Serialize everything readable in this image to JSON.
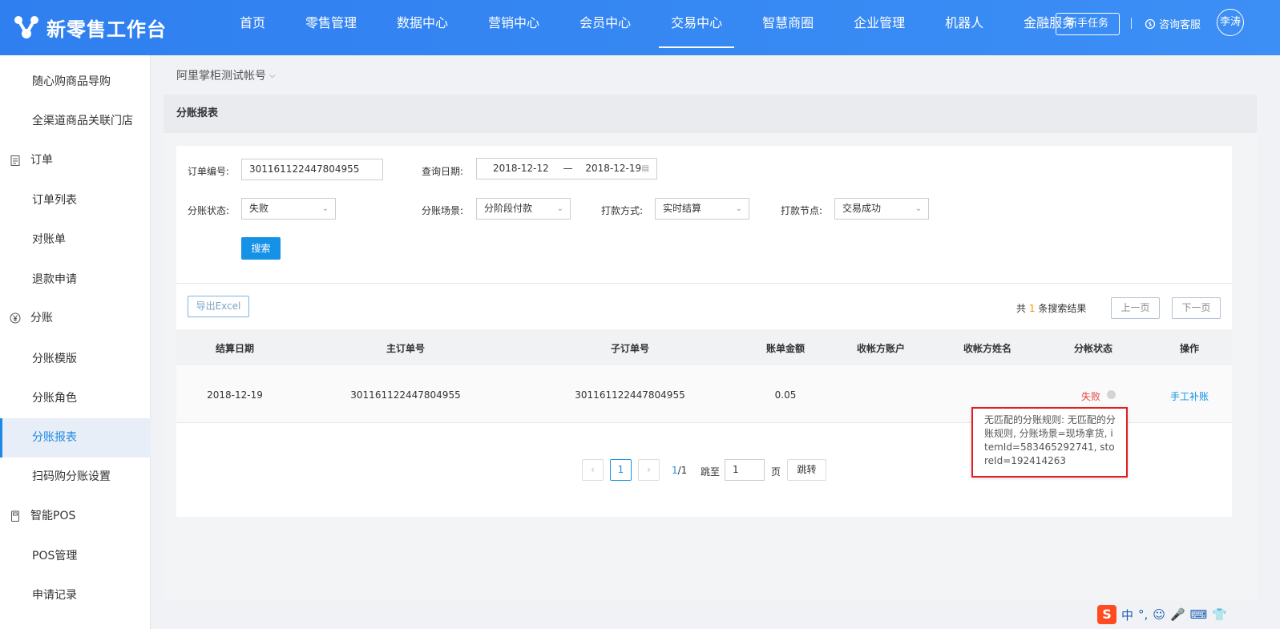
{
  "app": {
    "title": "新零售工作台"
  },
  "nav": {
    "items": [
      "首页",
      "零售管理",
      "数据中心",
      "营销中心",
      "会员中心",
      "交易中心",
      "智慧商圈",
      "企业管理",
      "机器人",
      "金融服务"
    ],
    "active_index": 5,
    "new_task": "新手任务",
    "support": "咨询客服",
    "avatar": "李涛"
  },
  "sidebar": {
    "items": [
      {
        "label": "随心购商品导购",
        "type": "item"
      },
      {
        "label": "全渠道商品关联门店",
        "type": "item"
      },
      {
        "label": "订单",
        "type": "group",
        "icon": "clipboard-icon"
      },
      {
        "label": "订单列表",
        "type": "item"
      },
      {
        "label": "对账单",
        "type": "item"
      },
      {
        "label": "退款申请",
        "type": "item"
      },
      {
        "label": "分账",
        "type": "group",
        "icon": "yen-icon"
      },
      {
        "label": "分账模版",
        "type": "item"
      },
      {
        "label": "分账角色",
        "type": "item"
      },
      {
        "label": "分账报表",
        "type": "item",
        "active": true
      },
      {
        "label": "扫码购分账设置",
        "type": "item"
      },
      {
        "label": "智能POS",
        "type": "group",
        "icon": "pos-icon"
      },
      {
        "label": "POS管理",
        "type": "item"
      },
      {
        "label": "申请记录",
        "type": "item"
      }
    ]
  },
  "breadcrumb": {
    "account": "阿里掌柜测试帐号"
  },
  "panel": {
    "title": "分账报表"
  },
  "filters": {
    "order_no_label": "订单编号:",
    "order_no_value": "301161122447804955",
    "date_label": "查询日期:",
    "date_start": "2018-12-12",
    "date_sep": "—",
    "date_end": "2018-12-19",
    "status_label": "分账状态:",
    "status_value": "失败",
    "scene_label": "分账场景:",
    "scene_value": "分阶段付款",
    "pay_method_label": "打款方式:",
    "pay_method_value": "实时结算",
    "pay_node_label": "打款节点:",
    "pay_node_value": "交易成功",
    "search_button": "搜索"
  },
  "results": {
    "export_button": "导出Excel",
    "count_prefix": "共",
    "count": "1",
    "count_suffix": "条搜索结果",
    "prev_button": "上一页",
    "next_button": "下一页"
  },
  "table": {
    "headers": [
      "结算日期",
      "主订单号",
      "子订单号",
      "账单金额",
      "收帐方账户",
      "收帐方姓名",
      "分帐状态",
      "操作"
    ],
    "rows": [
      {
        "date": "2018-12-19",
        "main_order": "301161122447804955",
        "sub_order": "301161122447804955",
        "amount": "0.05",
        "account": "",
        "name": "",
        "status": "失败",
        "action": "手工补账"
      }
    ]
  },
  "tooltip": {
    "text": "无匹配的分账规则: 无匹配的分账规则, 分账场景=现场拿货, itemId=583465292741, storeId=192414263"
  },
  "pagination": {
    "prev": "‹",
    "current": "1",
    "next": "›",
    "page_current": "1",
    "page_total": "/1",
    "jump_label": "跳至",
    "jump_value": "1",
    "page_unit": "页",
    "jump_button": "跳转"
  },
  "ime": {
    "items": [
      "中",
      "°,",
      "☺",
      "🎤",
      "⌨",
      "👕"
    ]
  }
}
